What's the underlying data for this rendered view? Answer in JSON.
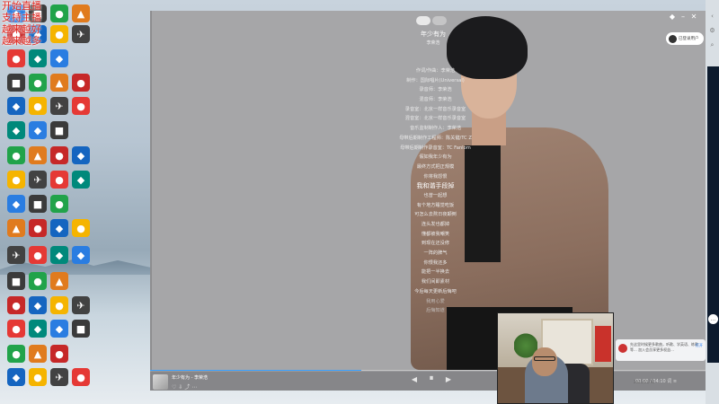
{
  "desktop": {
    "overlay_lines": [
      "开始直播",
      "支持主播",
      "越来越好",
      "越来越多"
    ],
    "icons": [
      {
        "name": "desktop-icon-1",
        "color": "#2a7de1",
        "glyph": "◆"
      },
      {
        "name": "desktop-icon-2",
        "color": "#3b3b3b",
        "glyph": "■"
      },
      {
        "name": "desktop-icon-3",
        "color": "#21a34a",
        "glyph": "●"
      },
      {
        "name": "desktop-icon-4",
        "color": "#e07b1e",
        "glyph": "▲"
      },
      {
        "name": "desktop-icon-5",
        "color": "#c62828",
        "glyph": "●"
      },
      {
        "name": "desktop-icon-6",
        "color": "#1565c0",
        "glyph": "◆"
      },
      {
        "name": "desktop-icon-7",
        "color": "#f5b400",
        "glyph": "●"
      },
      {
        "name": "desktop-icon-8",
        "color": "#424242",
        "glyph": "✈"
      },
      {
        "name": "desktop-icon-9",
        "color": "#e53935",
        "glyph": "●"
      },
      {
        "name": "desktop-icon-10",
        "color": "#00897b",
        "glyph": "◆"
      }
    ]
  },
  "window": {
    "tabs": [
      "",
      ""
    ],
    "song_title": "年少有为",
    "artist": "李荣浩",
    "lyrics": [
      "作词/作曲：李荣浩",
      "制作：国际唱片(Universal)",
      "录音师：李荣浩",
      "混音师：李荣浩",
      "录音室：北京一样音乐录音室",
      "混音室：北京一样音乐录音室",
      "音乐监制制作人：李荣浩",
      "母带后期制作工程师：陈关键/TC Z",
      "母带后期制作录音室：TC Fanlom",
      "假如我年少有为",
      "最终方式把正规模",
      "你将我怨恨",
      "我和谐手段掉",
      "也曾一起想",
      "有个地方睡觉吃饭",
      "可怎么去熬日夜颠倒",
      "连头发也都掉",
      "懂都被我嘲笑",
      "到现在还没修",
      "一阵的脾气",
      "你恨我还多",
      "能把一半换去",
      "我们间即素材",
      "今后每天更新后悔吧",
      "我用心爱",
      "后悔知道"
    ],
    "active_lyric_index": 12,
    "user_badge": "已登录用户",
    "now_playing": {
      "title": "年少有为 - 李荣浩",
      "progress": 0.38
    },
    "controls": {
      "prev": "◀",
      "play": "⏸",
      "next": "▶"
    },
    "bar_right_text": "00:00 / 04:10  词  ≡"
  },
  "notification": {
    "text": "先这里时候更多歌曲，听歌、学英语、练歌等... 加入会员享更多权益...",
    "button": "打开"
  },
  "taskbar_text": "2021/11/30"
}
